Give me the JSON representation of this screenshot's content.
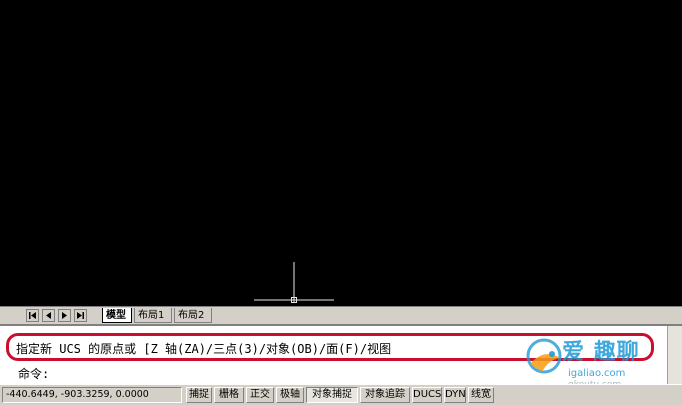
{
  "layout_tabs": [
    "模型",
    "布局1",
    "布局2"
  ],
  "command": {
    "prompt_text": "指定新 UCS 的原点或 [Z 轴(ZA)/三点(3)/对象(OB)/面(F)/视图",
    "input_label": "命令:"
  },
  "status": {
    "coordinates": "-440.6449, -903.3259, 0.0000",
    "buttons": [
      "捕捉",
      "栅格",
      "正交",
      "极轴",
      "对象捕捉",
      "对象追踪",
      "DUCS",
      "DYN",
      "线宽"
    ]
  },
  "watermark": {
    "brand": "爱 趣聊",
    "site": "igaliao.com",
    "sub": "qkoutu.com"
  },
  "colors": {
    "canvas": "#000000",
    "highlight": "#c8102e",
    "watermark": "#1e9ad6"
  },
  "icons": [
    "first-layout-icon",
    "prev-layout-icon",
    "next-layout-icon",
    "last-layout-icon",
    "crosshair-cursor-icon"
  ]
}
